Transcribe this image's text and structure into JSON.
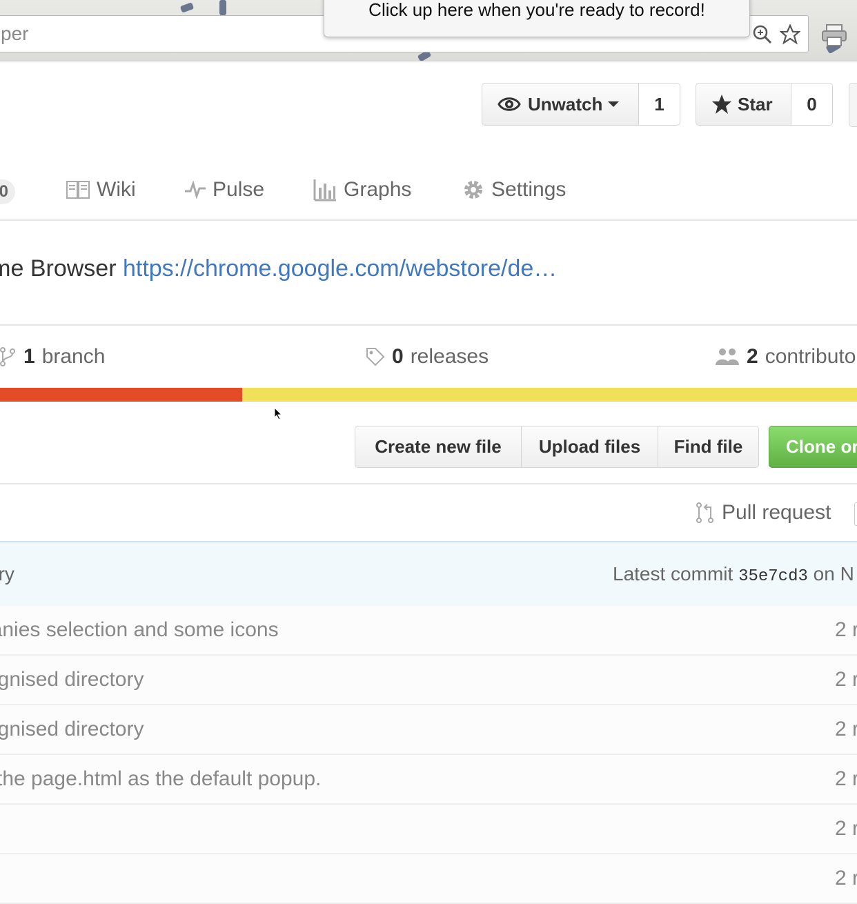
{
  "browser": {
    "url_fragment": "per",
    "tooltip": "Click up here when you're ready to record!"
  },
  "repo_actions": {
    "watch_label": "Unwatch",
    "watch_count": "1",
    "star_label": "Star",
    "star_count": "0"
  },
  "tabs": {
    "counter": "0",
    "items": [
      {
        "label": "Wiki",
        "icon": "book-icon"
      },
      {
        "label": "Pulse",
        "icon": "pulse-icon"
      },
      {
        "label": "Graphs",
        "icon": "graph-icon"
      },
      {
        "label": "Settings",
        "icon": "gear-icon"
      }
    ]
  },
  "description": {
    "text": "hrome Browser ",
    "link": "https://chrome.google.com/webstore/de…"
  },
  "summary": {
    "branches_count": "1",
    "branches_label": "branch",
    "releases_count": "0",
    "releases_label": "releases",
    "contributors_count": "2",
    "contributors_label": "contributo"
  },
  "language_bar": [
    {
      "color": "#e34c26",
      "fraction": 0.283
    },
    {
      "color": "#f1e05a",
      "fraction": 0.717
    }
  ],
  "file_nav": {
    "create": "Create new file",
    "upload": "Upload files",
    "find": "Find file",
    "clone": "Clone or"
  },
  "pull_request": "Pull request",
  "commit_tease": {
    "message": "ory",
    "latest_prefix": "Latest commit",
    "sha": "35e7cd3",
    "suffix": "on N"
  },
  "files": [
    {
      "message": "panies selection and some icons",
      "age": "2 r"
    },
    {
      "message": "orgnised directory",
      "age": "2 r"
    },
    {
      "message": "orgnised directory",
      "age": "2 r"
    },
    {
      "message": "e the page.html as the default popup.",
      "age": "2 r"
    },
    {
      "message": "",
      "age": "2 r"
    },
    {
      "message": "",
      "age": "2 r"
    }
  ]
}
